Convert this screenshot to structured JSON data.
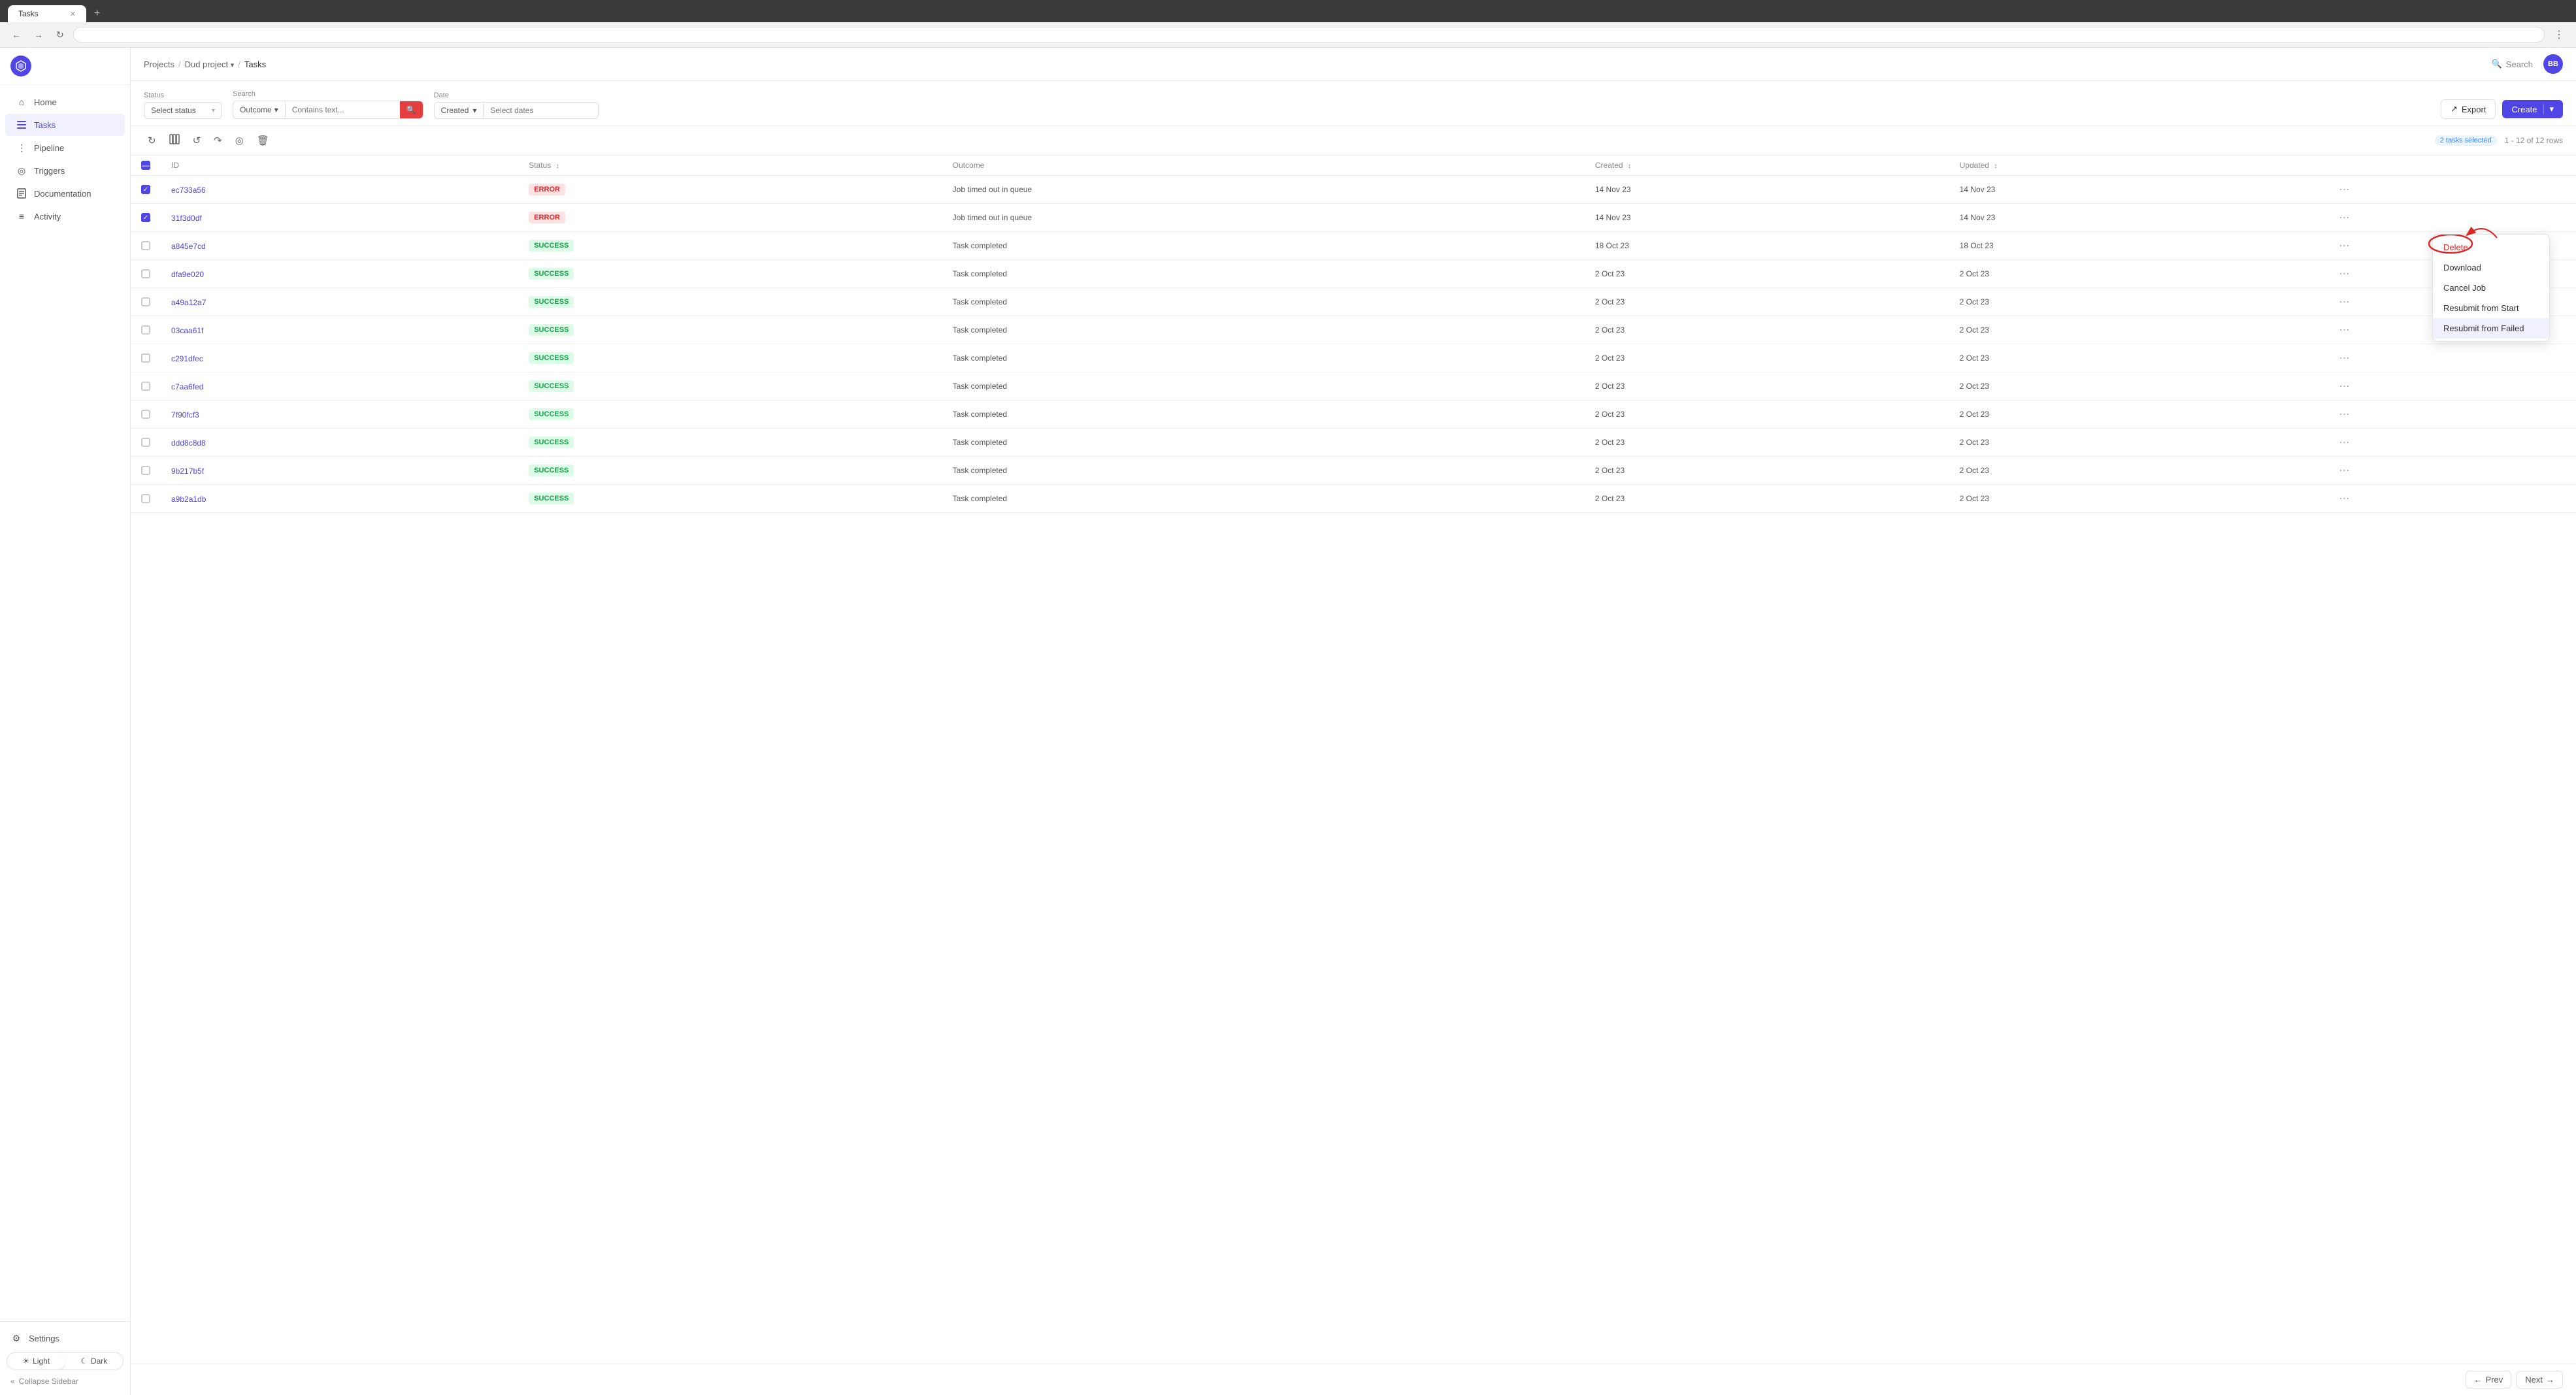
{
  "browser": {
    "tab_title": "Tasks",
    "address": "",
    "new_tab_icon": "+",
    "back_icon": "←",
    "forward_icon": "→",
    "refresh_icon": "↻",
    "more_icon": "⋮"
  },
  "sidebar": {
    "logo_initials": "⬡",
    "grid_icon": "⊞",
    "items": [
      {
        "id": "home",
        "label": "Home",
        "icon": "⌂",
        "active": false
      },
      {
        "id": "tasks",
        "label": "Tasks",
        "icon": "☰",
        "active": true
      },
      {
        "id": "pipeline",
        "label": "Pipeline",
        "icon": "⋮",
        "active": false
      },
      {
        "id": "triggers",
        "label": "Triggers",
        "icon": "◎",
        "active": false
      },
      {
        "id": "documentation",
        "label": "Documentation",
        "icon": "📄",
        "active": false
      },
      {
        "id": "activity",
        "label": "Activity",
        "icon": "≡",
        "active": false
      }
    ],
    "settings_label": "Settings",
    "settings_icon": "⚙",
    "theme": {
      "light_label": "Light",
      "dark_label": "Dark",
      "light_icon": "☀",
      "dark_icon": "☾",
      "active": "light"
    },
    "collapse_label": "Collapse Sidebar",
    "collapse_icon": "«"
  },
  "topbar": {
    "breadcrumbs": [
      {
        "label": "Projects",
        "link": true
      },
      {
        "label": "Dud project",
        "link": true,
        "has_dropdown": true
      },
      {
        "label": "Tasks",
        "link": false
      }
    ],
    "search_label": "Search",
    "search_icon": "🔍",
    "user_initials": "BB"
  },
  "filters": {
    "status_label": "Status",
    "status_placeholder": "Select status",
    "search_label": "Search",
    "search_type": "Outcome",
    "search_placeholder": "Contains text...",
    "date_label": "Date",
    "date_type": "Created",
    "date_placeholder": "Select dates",
    "export_label": "Export",
    "export_icon": "↗",
    "create_label": "Create",
    "create_arrow": "▾"
  },
  "toolbar": {
    "refresh_icon": "↻",
    "columns_icon": "⊞",
    "reload_icon": "↺",
    "redo_icon": "↷",
    "target_icon": "◎",
    "delete_icon": "🗑",
    "selected_text": "2 tasks selected",
    "rows_text": "1 - 12 of 12 rows"
  },
  "table": {
    "columns": [
      {
        "id": "checkbox",
        "label": ""
      },
      {
        "id": "id",
        "label": "ID",
        "sortable": false
      },
      {
        "id": "status",
        "label": "Status",
        "sortable": true
      },
      {
        "id": "outcome",
        "label": "Outcome",
        "sortable": false
      },
      {
        "id": "created",
        "label": "Created",
        "sortable": true
      },
      {
        "id": "updated",
        "label": "Updated",
        "sortable": true
      }
    ],
    "rows": [
      {
        "id": "ec733a56",
        "status": "ERROR",
        "outcome": "Job timed out in queue",
        "created": "14 Nov 23",
        "updated": "14 Nov 23",
        "checked": true
      },
      {
        "id": "31f3d0df",
        "status": "ERROR",
        "outcome": "Job timed out in queue",
        "created": "14 Nov 23",
        "updated": "14 Nov 23",
        "checked": true
      },
      {
        "id": "a845e7cd",
        "status": "SUCCESS",
        "outcome": "Task completed",
        "created": "18 Oct 23",
        "updated": "18 Oct 23",
        "checked": false
      },
      {
        "id": "dfa9e020",
        "status": "SUCCESS",
        "outcome": "Task completed",
        "created": "2 Oct 23",
        "updated": "2 Oct 23",
        "checked": false
      },
      {
        "id": "a49a12a7",
        "status": "SUCCESS",
        "outcome": "Task completed",
        "created": "2 Oct 23",
        "updated": "2 Oct 23",
        "checked": false
      },
      {
        "id": "03caa61f",
        "status": "SUCCESS",
        "outcome": "Task completed",
        "created": "2 Oct 23",
        "updated": "2 Oct 23",
        "checked": false
      },
      {
        "id": "c291dfec",
        "status": "SUCCESS",
        "outcome": "Task completed",
        "created": "2 Oct 23",
        "updated": "2 Oct 23",
        "checked": false
      },
      {
        "id": "c7aa6fed",
        "status": "SUCCESS",
        "outcome": "Task completed",
        "created": "2 Oct 23",
        "updated": "2 Oct 23",
        "checked": false
      },
      {
        "id": "7f90fcf3",
        "status": "SUCCESS",
        "outcome": "Task completed",
        "created": "2 Oct 23",
        "updated": "2 Oct 23",
        "checked": false
      },
      {
        "id": "ddd8c8d8",
        "status": "SUCCESS",
        "outcome": "Task completed",
        "created": "2 Oct 23",
        "updated": "2 Oct 23",
        "checked": false
      },
      {
        "id": "9b217b5f",
        "status": "SUCCESS",
        "outcome": "Task completed",
        "created": "2 Oct 23",
        "updated": "2 Oct 23",
        "checked": false
      },
      {
        "id": "a9b2a1db",
        "status": "SUCCESS",
        "outcome": "Task completed",
        "created": "2 Oct 23",
        "updated": "2 Oct 23",
        "checked": false
      }
    ]
  },
  "context_menu": {
    "visible": true,
    "row_index": 1,
    "items": [
      {
        "id": "delete",
        "label": "Delete",
        "type": "delete"
      },
      {
        "id": "download",
        "label": "Download",
        "type": "normal"
      },
      {
        "id": "cancel-job",
        "label": "Cancel Job",
        "type": "normal"
      },
      {
        "id": "resubmit-start",
        "label": "Resubmit from Start",
        "type": "normal"
      },
      {
        "id": "resubmit-failed",
        "label": "Resubmit from Failed",
        "type": "highlighted"
      }
    ]
  },
  "pagination": {
    "prev_icon": "←",
    "prev_label": "Prev",
    "next_icon": "→",
    "next_label": "Next"
  }
}
